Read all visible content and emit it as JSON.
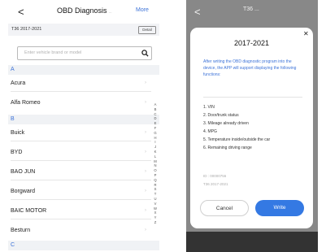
{
  "left": {
    "nav": {
      "back": "<",
      "title": "OBD Diagnosis",
      "subtitle": "...",
      "more": "More"
    },
    "info": {
      "model": "T36 2017-2021",
      "detail": "Detail"
    },
    "search": {
      "placeholder": "Enter vehicle brand or model"
    },
    "sections": [
      "A",
      "B",
      "C"
    ],
    "brands": [
      "Acura",
      "Alfa Romeo",
      "Buick",
      "BYD",
      "BAO JUN",
      "Borgward",
      "BAIC MOTOR",
      "Besturn"
    ],
    "chevron": "›",
    "index": [
      "A",
      "B",
      "C",
      "D",
      "E",
      "F",
      "G",
      "H",
      "I",
      "J",
      "K",
      "L",
      "M",
      "N",
      "O",
      "P",
      "Q",
      "R",
      "S",
      "T",
      "U",
      "V",
      "W",
      "X",
      "Y",
      "Z"
    ]
  },
  "right": {
    "nav": {
      "back": "<",
      "title": "T36 ..."
    },
    "dialog": {
      "close": "✕",
      "title": "2017-2021",
      "desc": "After writing the OBD diagnostic program into the device, the APP will support displaying the following functions:",
      "features": [
        "1. VIN",
        "2. Door/trunk status",
        "3. Mileage already driven",
        "4. MPG",
        "5. Temperature inside/outside the car",
        "6. Remaining driving range"
      ],
      "id": "ID : 00000756",
      "model": "T36 2017-2021",
      "cancel": "Cancel",
      "write": "Write"
    }
  },
  "colors": {
    "accent": "#3d73d8",
    "button": "#3479e3",
    "overlay": "#888888"
  },
  "icons": {
    "search": "magnifier-icon",
    "close": "close-icon",
    "chevron": "chevron-right-icon"
  }
}
